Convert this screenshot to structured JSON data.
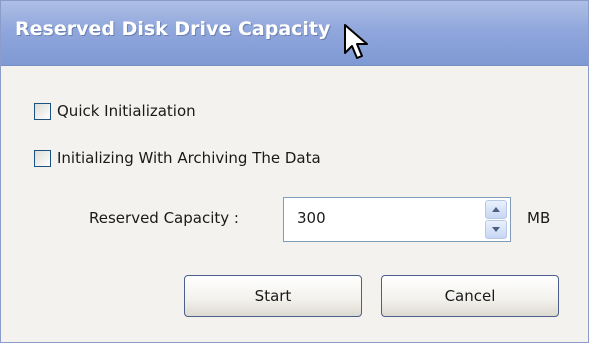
{
  "window": {
    "title": "Reserved Disk Drive Capacity"
  },
  "options": [
    {
      "label": "Quick Initialization",
      "checked": false
    },
    {
      "label": "Initializing With Archiving The Data",
      "checked": false
    }
  ],
  "capacity": {
    "label": "Reserved Capacity :",
    "value": "300",
    "unit": "MB"
  },
  "buttons": {
    "start": "Start",
    "cancel": "Cancel"
  },
  "icons": {
    "cursor": "mouse-pointer-icon",
    "spin_up": "chevron-up-icon",
    "spin_down": "chevron-down-icon"
  }
}
